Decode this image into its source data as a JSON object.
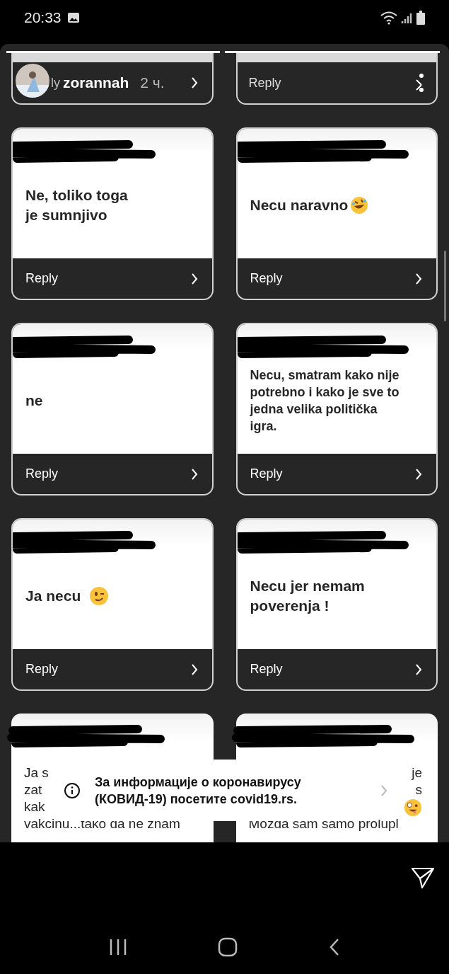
{
  "status_bar": {
    "time": "20:33"
  },
  "story_header": {
    "left": {
      "label_fragment": "ly",
      "username": "zorannah",
      "age": "2 ч."
    },
    "right": {
      "label": "Reply"
    }
  },
  "cards": [
    {
      "lines": [
        "Ne, toliko toga",
        "je sumnjivo"
      ],
      "kind": "short",
      "reply": "Reply"
    },
    {
      "lines": [
        "Necu naravno"
      ],
      "kind": "laughing",
      "reply": "Reply"
    },
    {
      "lines": [
        "ne"
      ],
      "kind": "short",
      "reply": "Reply"
    },
    {
      "lines": [
        "Necu, smatram kako nije",
        "potrebno i kako je sve to",
        "jedna velika politička",
        "igra."
      ],
      "kind": "long",
      "reply": "Reply"
    },
    {
      "lines": [
        "Ja necu"
      ],
      "kind": "winking",
      "reply": "Reply"
    },
    {
      "lines": [
        "Necu jer nemam",
        "poverenja !"
      ],
      "kind": "short",
      "reply": "Reply"
    }
  ],
  "partial_cards": [
    {
      "lines": [
        {
          "text": "Ja s",
          "kind": "head"
        },
        {
          "text": "zat",
          "kind": "head"
        },
        {
          "text": "kak",
          "kind": "head"
        },
        {
          "text": "vakcinu...tako da ne znam",
          "kind": "full"
        }
      ]
    },
    {
      "lines": [
        {
          "text": "je",
          "kind": "tail"
        },
        {
          "text": "s",
          "kind": "tail"
        },
        {
          "kind": "emoji"
        },
        {
          "text": "Mozda sam samo prolupl",
          "kind": "full"
        }
      ]
    }
  ],
  "toast": {
    "lines": [
      "За информације о коронавирусу",
      "(КОВИД-19) посетите covid19.rs."
    ]
  }
}
